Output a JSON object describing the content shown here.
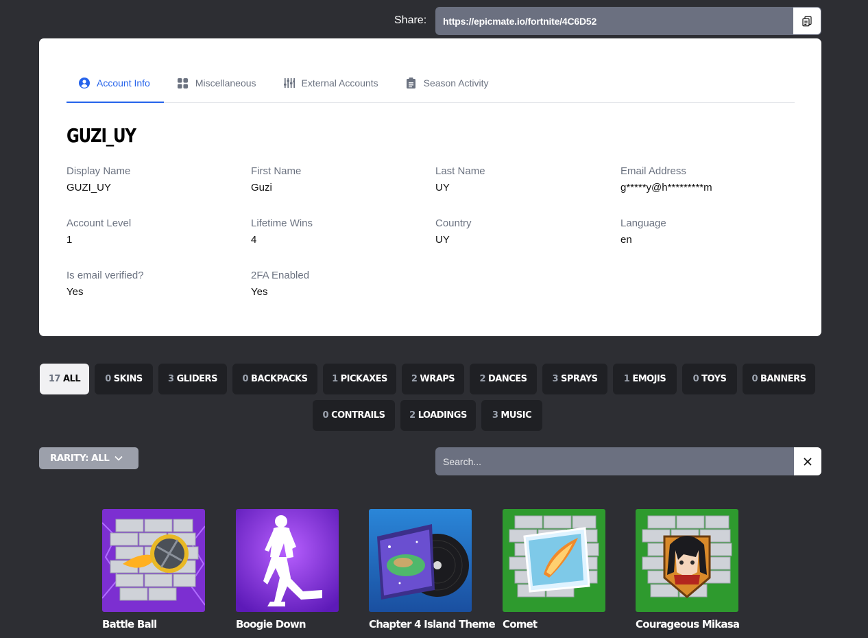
{
  "share": {
    "label": "Share:",
    "url": "https://epicmate.io/fortnite/4C6D52",
    "copy_icon": "clipboard-copy-icon"
  },
  "tabs": [
    {
      "label": "Account Info",
      "icon": "user-circle-icon",
      "active": true
    },
    {
      "label": "Miscellaneous",
      "icon": "grid-icon",
      "active": false
    },
    {
      "label": "External Accounts",
      "icon": "sliders-icon",
      "active": false
    },
    {
      "label": "Season Activity",
      "icon": "clipboard-list-icon",
      "active": false
    }
  ],
  "account": {
    "username": "GUZI_UY",
    "fields": [
      {
        "label": "Display Name",
        "value": "GUZI_UY"
      },
      {
        "label": "First Name",
        "value": "Guzi"
      },
      {
        "label": "Last Name",
        "value": "UY"
      },
      {
        "label": "Email Address",
        "value": "g*****y@h*********m"
      },
      {
        "label": "Account Level",
        "value": "1"
      },
      {
        "label": "Lifetime Wins",
        "value": "4"
      },
      {
        "label": "Country",
        "value": "UY"
      },
      {
        "label": "Language",
        "value": "en"
      },
      {
        "label": "Is email verified?",
        "value": "Yes"
      },
      {
        "label": "2FA Enabled",
        "value": "Yes"
      }
    ]
  },
  "categories": [
    {
      "count": "17",
      "label": "ALL",
      "active": true
    },
    {
      "count": "0",
      "label": "SKINS"
    },
    {
      "count": "3",
      "label": "GLIDERS"
    },
    {
      "count": "0",
      "label": "BACKPACKS"
    },
    {
      "count": "1",
      "label": "PICKAXES"
    },
    {
      "count": "2",
      "label": "WRAPS"
    },
    {
      "count": "2",
      "label": "DANCES"
    },
    {
      "count": "3",
      "label": "SPRAYS"
    },
    {
      "count": "1",
      "label": "EMOJIS"
    },
    {
      "count": "0",
      "label": "TOYS"
    },
    {
      "count": "0",
      "label": "BANNERS"
    },
    {
      "count": "0",
      "label": "CONTRAILS"
    },
    {
      "count": "2",
      "label": "LOADINGS"
    },
    {
      "count": "3",
      "label": "MUSIC"
    }
  ],
  "filters": {
    "rarity_label": "RARITY: ALL",
    "search_placeholder": "Search...",
    "clear_icon": "close-icon"
  },
  "items": [
    {
      "name": "Battle Ball",
      "icon": "spray-battle-ball-icon"
    },
    {
      "name": "Boogie Down",
      "icon": "emote-dancer-icon"
    },
    {
      "name": "Chapter 4 Island Theme",
      "icon": "music-record-icon"
    },
    {
      "name": "Comet",
      "icon": "spray-comet-icon"
    },
    {
      "name": "Courageous Mikasa",
      "icon": "spray-mikasa-icon"
    }
  ],
  "colors": {
    "background": "#2d2e33",
    "accent": "#2563eb",
    "card": "#ffffff",
    "button_dark": "#1f2024"
  }
}
